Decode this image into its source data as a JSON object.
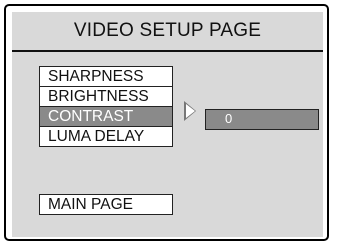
{
  "header": {
    "title": "VIDEO SETUP PAGE"
  },
  "menu": {
    "items": [
      {
        "label": "SHARPNESS"
      },
      {
        "label": "BRIGHTNESS"
      },
      {
        "label": "CONTRAST"
      },
      {
        "label": "LUMA DELAY"
      }
    ],
    "selected": "CONTRAST"
  },
  "submenu": {
    "value": "0"
  },
  "footer": {
    "main_page_label": "MAIN PAGE"
  },
  "colors": {
    "panel": "#d9d9d9",
    "selected": "#8a8a8a",
    "border": "#222222"
  },
  "icons": {
    "submenu_arrow": "right-arrow-icon"
  }
}
